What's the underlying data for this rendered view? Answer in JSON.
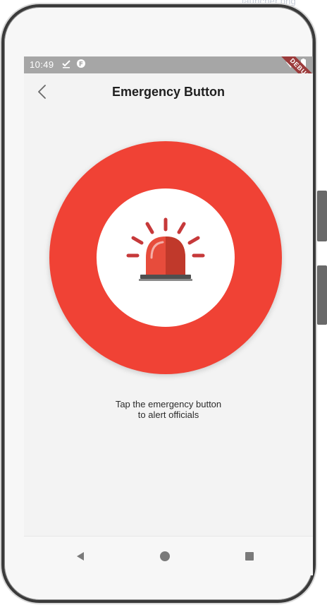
{
  "source_label": "launcher.png",
  "status_bar": {
    "time": "10:49",
    "debug_banner": "DEBUG"
  },
  "app_bar": {
    "title": "Emergency Button"
  },
  "main": {
    "instruction_line1": "Tap the emergency button",
    "instruction_line2": "to alert officials"
  },
  "icons": {
    "back": "back-arrow-icon",
    "siren": "siren-icon",
    "nav_back": "nav-back-icon",
    "nav_home": "nav-home-icon",
    "nav_recents": "nav-recents-icon"
  },
  "colors": {
    "emergency_red": "#f04235",
    "siren_red": "#e74c3c",
    "status_gray": "#a6a6a6",
    "background": "#f3f3f3"
  }
}
